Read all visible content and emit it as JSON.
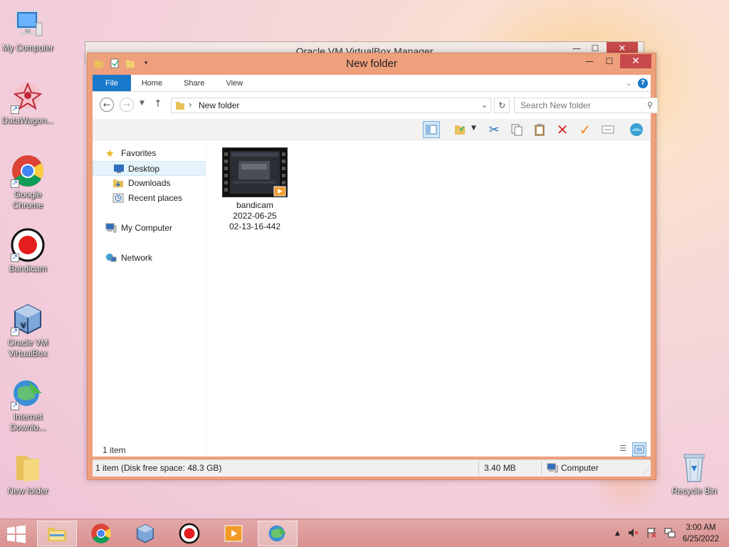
{
  "desktop": {
    "icons": [
      {
        "label": "My Computer",
        "icon": "my-computer-icon"
      },
      {
        "label": "DataWagon...",
        "icon": "datawagon-icon"
      },
      {
        "label": "Google Chrome",
        "icon": "chrome-icon"
      },
      {
        "label": "Bandicam",
        "icon": "bandicam-icon"
      },
      {
        "label": "Oracle VM VirtualBox",
        "icon": "virtualbox-icon"
      },
      {
        "label": "Internet Downlo...",
        "icon": "internet-download-manager-icon"
      },
      {
        "label": "New folder",
        "icon": "folder-icon"
      },
      {
        "label": "Recycle Bin",
        "icon": "recycle-bin-icon"
      }
    ]
  },
  "back_window": {
    "title": "Oracle VM VirtualBox Manager",
    "close": "✕"
  },
  "explorer": {
    "title": "New folder",
    "window_buttons": {
      "minimize": "—",
      "maximize": "☐",
      "close": "✕"
    },
    "ribbon_tabs": [
      "File",
      "Home",
      "Share",
      "View"
    ],
    "address": {
      "path": "New folder",
      "separator": "›"
    },
    "search": {
      "placeholder": "Search New folder"
    },
    "nav": {
      "favorites": "Favorites",
      "desktop": "Desktop",
      "downloads": "Downloads",
      "recent": "Recent places",
      "computer": "My Computer",
      "network": "Network"
    },
    "file": {
      "name_line1": "bandicam",
      "name_line2": "2022-06-25",
      "name_line3": "02-13-16-442"
    },
    "item_count": "1 item",
    "status": {
      "left": "1 item (Disk free space: 48.3 GB)",
      "size": "3.40 MB",
      "location": "Computer"
    }
  },
  "taskbar": {
    "clock_time": "3:00 AM",
    "clock_date": "6/25/2022",
    "tray_arrow": "▲"
  },
  "colors": {
    "window_frame": "#ee9f7b",
    "file_tab": "#1979ca",
    "close_button": "#c7494b",
    "taskbar": "#d89191"
  }
}
